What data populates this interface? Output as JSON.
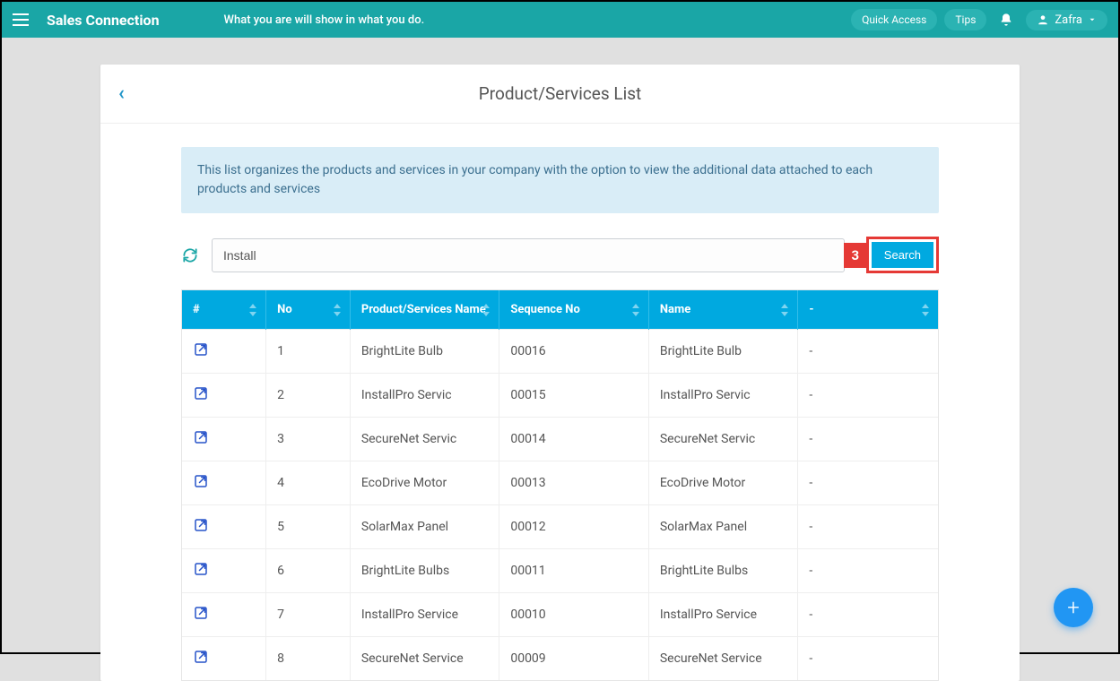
{
  "header": {
    "brand": "Sales Connection",
    "tagline": "What you are will show in what you do.",
    "quick_access": "Quick Access",
    "tips": "Tips",
    "user": "Zafra"
  },
  "page": {
    "title": "Product/Services List",
    "info_banner": "This list organizes the products and services in your company with the option to view the additional data attached to each products and services"
  },
  "search": {
    "value": "Install",
    "button": "Search",
    "step_number": "3"
  },
  "table": {
    "columns": {
      "hash": "#",
      "no": "No",
      "ps_name": "Product/Services Name",
      "seq": "Sequence No",
      "name": "Name",
      "last": "-"
    },
    "rows": [
      {
        "no": "1",
        "ps_name": "BrightLite Bulb",
        "seq": "00016",
        "name": "BrightLite Bulb",
        "last": "-"
      },
      {
        "no": "2",
        "ps_name": "InstallPro Servic",
        "seq": "00015",
        "name": "InstallPro Servic",
        "last": "-"
      },
      {
        "no": "3",
        "ps_name": "SecureNet Servic",
        "seq": "00014",
        "name": "SecureNet Servic",
        "last": "-"
      },
      {
        "no": "4",
        "ps_name": "EcoDrive Motor",
        "seq": "00013",
        "name": "EcoDrive Motor",
        "last": "-"
      },
      {
        "no": "5",
        "ps_name": "SolarMax Panel",
        "seq": "00012",
        "name": "SolarMax Panel",
        "last": "-"
      },
      {
        "no": "6",
        "ps_name": "BrightLite Bulbs",
        "seq": "00011",
        "name": "BrightLite Bulbs",
        "last": "-"
      },
      {
        "no": "7",
        "ps_name": "InstallPro Service",
        "seq": "00010",
        "name": "InstallPro Service",
        "last": "-"
      },
      {
        "no": "8",
        "ps_name": "SecureNet Service",
        "seq": "00009",
        "name": "SecureNet Service",
        "last": "-"
      }
    ]
  }
}
